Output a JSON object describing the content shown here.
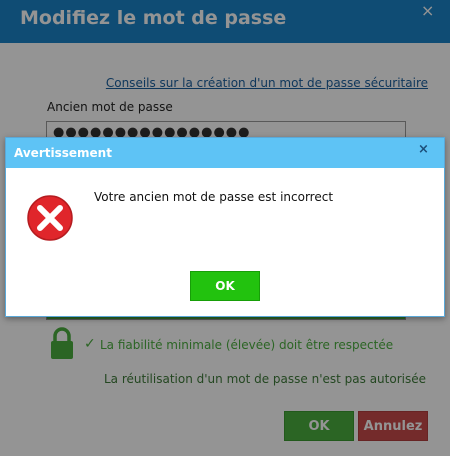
{
  "background_dialog": {
    "title": "Modifiez le mot de passe",
    "close_glyph": "×",
    "tips_link": "Conseils sur la création d'un mot de passe sécuritaire",
    "old_password_label": "Ancien mot de passe",
    "old_password_value": "●●●●●●●●●●●●●●●●",
    "rules": {
      "reliability": "La fiabilité minimale (élevée) doit être respectée",
      "reuse": "La réutilisation d'un mot de passe n'est pas autorisée"
    },
    "ok_label": "OK",
    "cancel_label": "Annulez"
  },
  "alert": {
    "title": "Avertissement",
    "close_glyph": "×",
    "icon": "error-x-icon",
    "message": "Votre ancien mot de passe est incorrect",
    "ok_label": "OK"
  },
  "colors": {
    "header_blue": "#1b84c8",
    "alert_header": "#5ec3f5",
    "ok_green": "#22c20e",
    "cancel_red": "#c94a4a",
    "error_red": "#e0262b"
  }
}
